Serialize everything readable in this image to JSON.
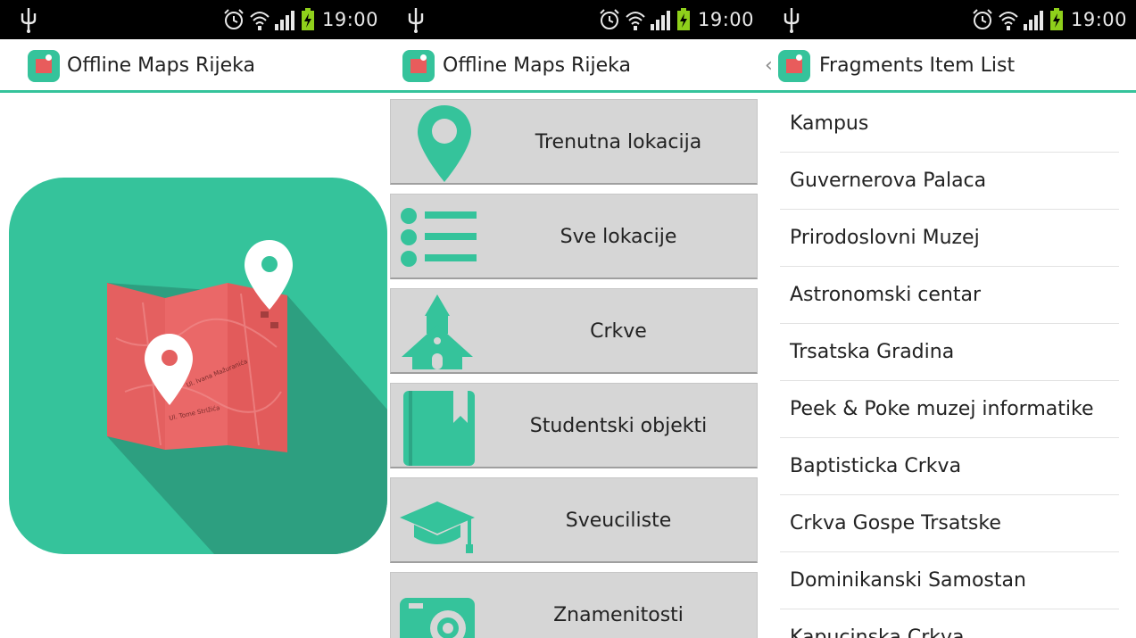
{
  "status_bar": {
    "time": "19:00"
  },
  "screens": [
    {
      "title": "Offline Maps Rijeka",
      "splash": {
        "street_labels": [
          "Ul. Ivana Mažuranića",
          "Ul. Tome Strižića"
        ]
      }
    },
    {
      "title": "Offline Maps Rijeka",
      "menu": [
        {
          "label": "Trenutna lokacija",
          "icon": "location-pin-icon"
        },
        {
          "label": "Sve lokacije",
          "icon": "list-icon"
        },
        {
          "label": "Crkve",
          "icon": "church-icon"
        },
        {
          "label": "Studentski objekti",
          "icon": "book-icon"
        },
        {
          "label": "Sveuciliste",
          "icon": "graduation-cap-icon"
        },
        {
          "label": "Znamenitosti",
          "icon": "camera-icon"
        }
      ]
    },
    {
      "title": "Fragments Item List",
      "items": [
        "Kampus",
        "Guvernerova Palaca",
        "Prirodoslovni Muzej",
        "Astronomski centar",
        "Trsatska Gradina",
        "Peek & Poke muzej informatike",
        "Baptisticka Crkva",
        "Crkva Gospe Trsatske",
        "Dominikanski Samostan",
        "Kapucinska Crkva"
      ]
    }
  ],
  "colors": {
    "accent": "#35c39b",
    "map_red": "#e85c5c",
    "button_gray": "#d6d6d6",
    "status_bar": "#000000"
  }
}
